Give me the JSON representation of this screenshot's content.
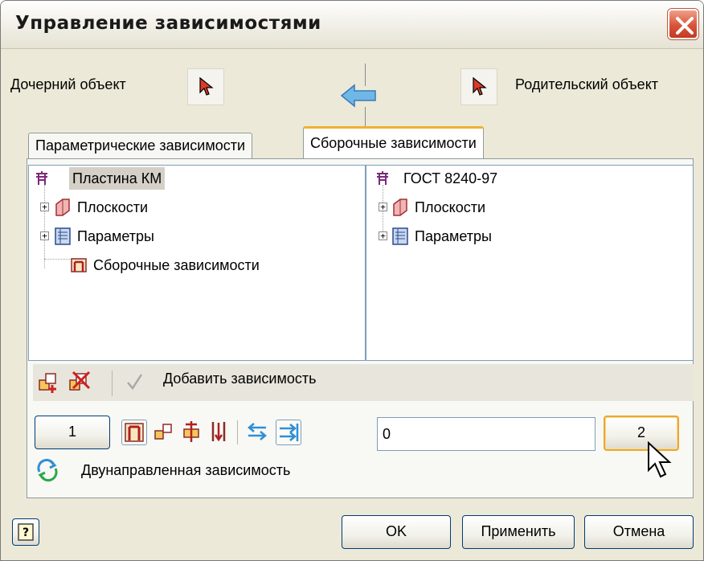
{
  "window": {
    "title": "Управление зависимостями"
  },
  "top": {
    "child_label": "Дочерний объект",
    "parent_label": "Родительский объект"
  },
  "tabs": [
    {
      "label": "Параметрические зависимости",
      "active": false
    },
    {
      "label": "Сборочные зависимости",
      "active": true
    }
  ],
  "left_tree": {
    "root": "Пластина КМ",
    "items": [
      "Плоскости",
      "Параметры",
      "Сборочные зависимости"
    ]
  },
  "right_tree": {
    "root": "ГОСТ 8240-97",
    "items": [
      "Плоскости",
      "Параметры"
    ]
  },
  "constraint_toolbar": {
    "label": "Добавить зависимость"
  },
  "bottom_row": {
    "button1_label": "1",
    "value": "0",
    "button2_label": "2",
    "direction_label": "Двунаправленная зависимость"
  },
  "footer": {
    "ok_label": "OK",
    "apply_label": "Применить",
    "cancel_label": "Отмена"
  },
  "icons": {
    "close": "close-icon",
    "pick": "cursor-pick-icon",
    "arrow": "arrow-left-icon",
    "help": "help-icon"
  },
  "colors": {
    "accent": "#F0B030",
    "pick_cursor": "#D93A2A",
    "arrow": "#6FB7E8"
  }
}
